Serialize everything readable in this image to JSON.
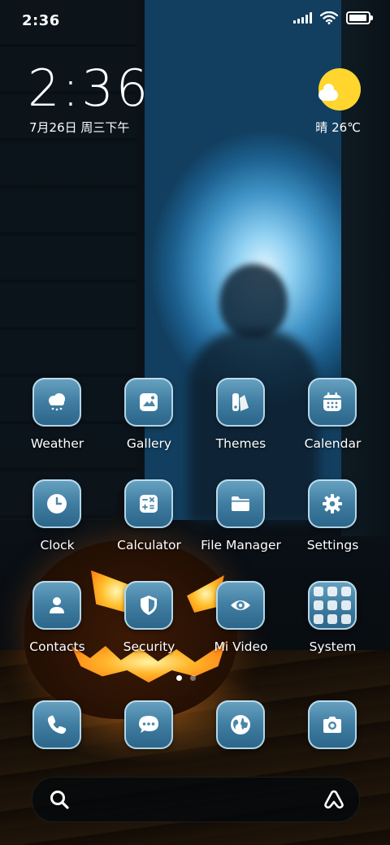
{
  "status_bar": {
    "time": "2:36",
    "battery_level": 0.95
  },
  "clock_widget": {
    "time": "2:36",
    "date": "7月26日 周三下午"
  },
  "weather_widget": {
    "text": "晴 26℃",
    "icon": "sun-cloud-icon"
  },
  "apps": [
    {
      "label": "Weather",
      "icon": "weather-icon"
    },
    {
      "label": "Gallery",
      "icon": "gallery-icon"
    },
    {
      "label": "Themes",
      "icon": "themes-icon"
    },
    {
      "label": "Calendar",
      "icon": "calendar-icon"
    },
    {
      "label": "Clock",
      "icon": "clock-icon"
    },
    {
      "label": "Calculator",
      "icon": "calculator-icon"
    },
    {
      "label": "File Manager",
      "icon": "folder-icon"
    },
    {
      "label": "Settings",
      "icon": "gear-icon"
    },
    {
      "label": "Contacts",
      "icon": "person-icon"
    },
    {
      "label": "Security",
      "icon": "shield-icon"
    },
    {
      "label": "Mi Video",
      "icon": "eye-icon"
    },
    {
      "label": "System",
      "icon": "folder-grid-icon"
    }
  ],
  "dock": [
    {
      "icon": "phone-icon"
    },
    {
      "icon": "message-icon"
    },
    {
      "icon": "browser-globe-icon"
    },
    {
      "icon": "camera-icon"
    }
  ],
  "page_indicator": {
    "current": 1,
    "total": 2
  },
  "colors": {
    "icon_gradient_top": "#6aa3c2",
    "icon_gradient_bottom": "#2b6488",
    "sun": "#ffd52e"
  }
}
